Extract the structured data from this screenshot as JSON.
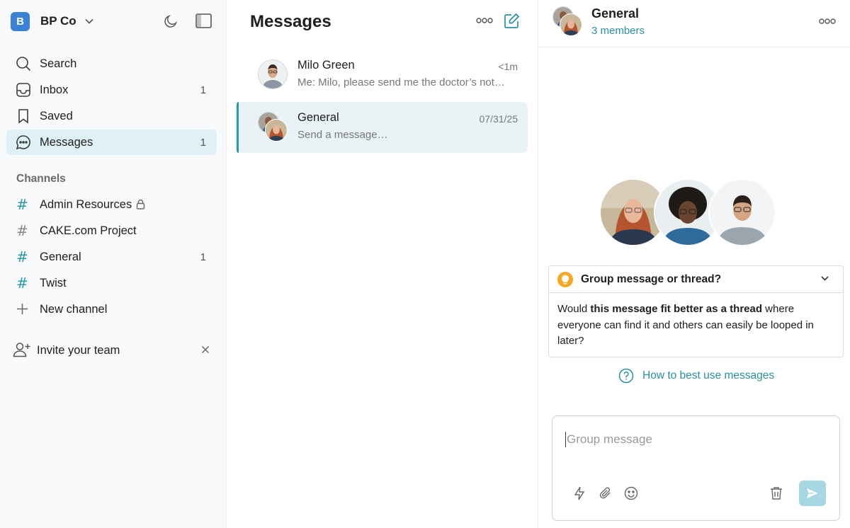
{
  "workspace": {
    "initial": "B",
    "name": "BP Co",
    "icons": {
      "dropdown": "chevron-down-icon",
      "theme": "moon-icon",
      "panel": "sidebar-toggle-icon"
    },
    "colors": {
      "avatar": "#3b82d6"
    }
  },
  "nav": [
    {
      "label": "Search",
      "count": "",
      "icon": "search-icon"
    },
    {
      "label": "Inbox",
      "count": "1",
      "icon": "inbox-icon"
    },
    {
      "label": "Saved",
      "count": "",
      "icon": "bookmark-icon"
    },
    {
      "label": "Messages",
      "count": "1",
      "icon": "chat-bubble-icon",
      "active": true
    }
  ],
  "channels": {
    "title": "Channels",
    "items": [
      {
        "label": "Admin Resources",
        "count": "",
        "locked": true
      },
      {
        "label": "CAKE.com Project",
        "count": ""
      },
      {
        "label": "General",
        "count": "1"
      },
      {
        "label": "Twist",
        "count": ""
      }
    ],
    "new_label": "New channel"
  },
  "invite": {
    "label": "Invite your team"
  },
  "messages": {
    "title": "Messages",
    "conversations": [
      {
        "name": "Milo Green",
        "time": "<1m",
        "preview": "Me: Milo, please send me the doctor’s not…"
      },
      {
        "name": "General",
        "time": "07/31/25",
        "preview": "Send a message…",
        "active": true
      }
    ]
  },
  "conversation": {
    "title": "General",
    "members": "3 members",
    "tip": {
      "title": "Group message or thread?",
      "body_pre": "Would ",
      "body_bold": "this message fit better as a thread",
      "body_post": " where everyone can find it and others can easily be looped in later?"
    },
    "help_link": "How to best use messages",
    "composer": {
      "placeholder": "Group message"
    }
  },
  "colors": {
    "accent": "#2a9aa8",
    "active_bg": "#e0f1f6",
    "tip_icon": "#f5a623",
    "send_disabled": "#a7d7e2"
  }
}
